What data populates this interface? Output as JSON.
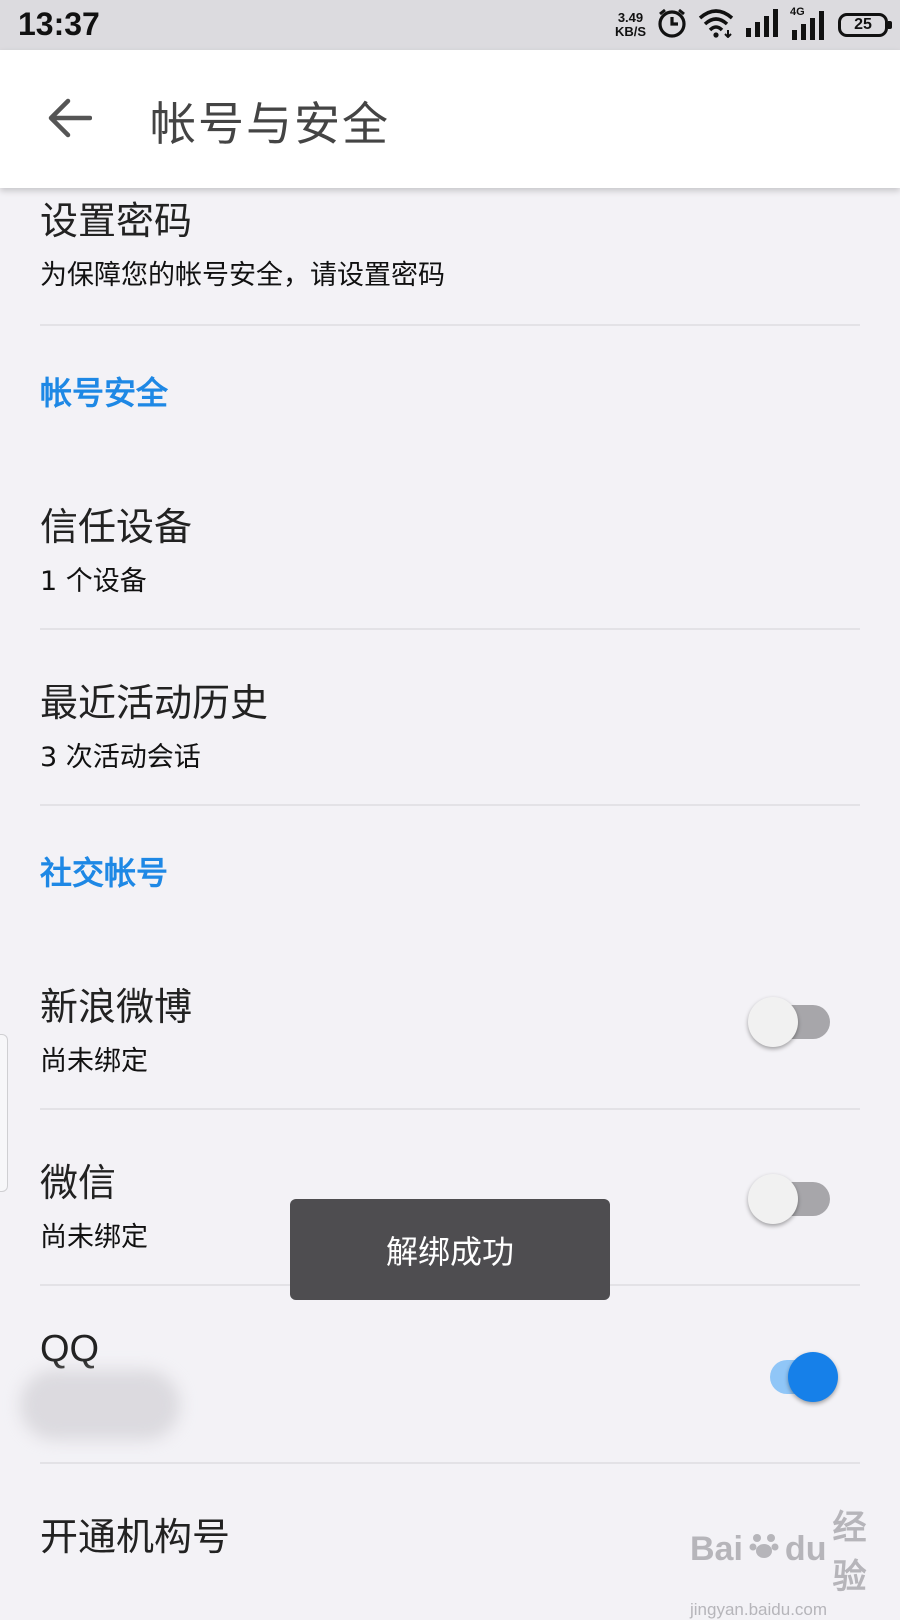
{
  "status_bar": {
    "time": "13:37",
    "net_speed_value": "3.49",
    "net_speed_unit": "KB/S",
    "mobile_label": "4G",
    "battery": "25"
  },
  "header": {
    "title": "帐号与安全",
    "back_icon": "arrow-left-icon"
  },
  "items": {
    "set_password": {
      "title": "设置密码",
      "subtitle": "为保障您的帐号安全，请设置密码"
    },
    "trusted_devices": {
      "title": "信任设备",
      "subtitle": "1 个设备"
    },
    "activity_history": {
      "title": "最近活动历史",
      "subtitle": "3 次活动会话"
    },
    "weibo": {
      "title": "新浪微博",
      "subtitle": "尚未绑定",
      "enabled": false
    },
    "wechat": {
      "title": "微信",
      "subtitle": "尚未绑定",
      "enabled": false
    },
    "qq": {
      "title": "QQ",
      "enabled": true
    },
    "org_account": {
      "title": "开通机构号"
    }
  },
  "sections": {
    "account_security": "帐号安全",
    "social_accounts": "社交帐号"
  },
  "toast": {
    "message": "解绑成功"
  },
  "watermark": {
    "brand_left": "Bai",
    "brand_right": "du",
    "brand_suffix": "经验",
    "url": "jingyan.baidu.com"
  },
  "colors": {
    "accent": "#1e88e5",
    "toggle_on": "#1680e9",
    "toggle_off_track": "#a7a6aa",
    "background": "#f3f2f6",
    "toast_bg": "#4e4d50"
  }
}
